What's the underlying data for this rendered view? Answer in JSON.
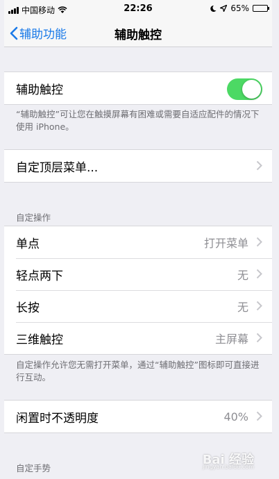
{
  "status_bar": {
    "carrier": "中国移动",
    "time": "22:26",
    "battery": "65%",
    "battery_fraction": 0.65
  },
  "nav": {
    "back_label": "辅助功能",
    "title": "辅助触控"
  },
  "assistive_touch": {
    "label": "辅助触控",
    "enabled": true,
    "description": "“辅助触控”可让您在触摸屏幕有困难或需要自适应配件的情况下使用 iPhone。"
  },
  "top_menu": {
    "label": "自定顶层菜单..."
  },
  "custom_actions": {
    "header": "自定操作",
    "rows": [
      {
        "label": "单点",
        "value": "打开菜单"
      },
      {
        "label": "轻点两下",
        "value": "无"
      },
      {
        "label": "长按",
        "value": "无"
      },
      {
        "label": "三维触控",
        "value": "主屏幕"
      }
    ],
    "footer": "自定操作允许您无需打开菜单，通过“辅助触控”图标即可直接进行互动。"
  },
  "idle_opacity": {
    "label": "闲置时不透明度",
    "value": "40%"
  },
  "custom_gestures": {
    "header": "自定手势"
  },
  "watermark": {
    "text": "Bai 经验",
    "sub": "jingyan.baidu.com"
  },
  "colors": {
    "accent": "#1a7ae8",
    "toggle_on": "#4cd964",
    "background": "#efeff4"
  }
}
